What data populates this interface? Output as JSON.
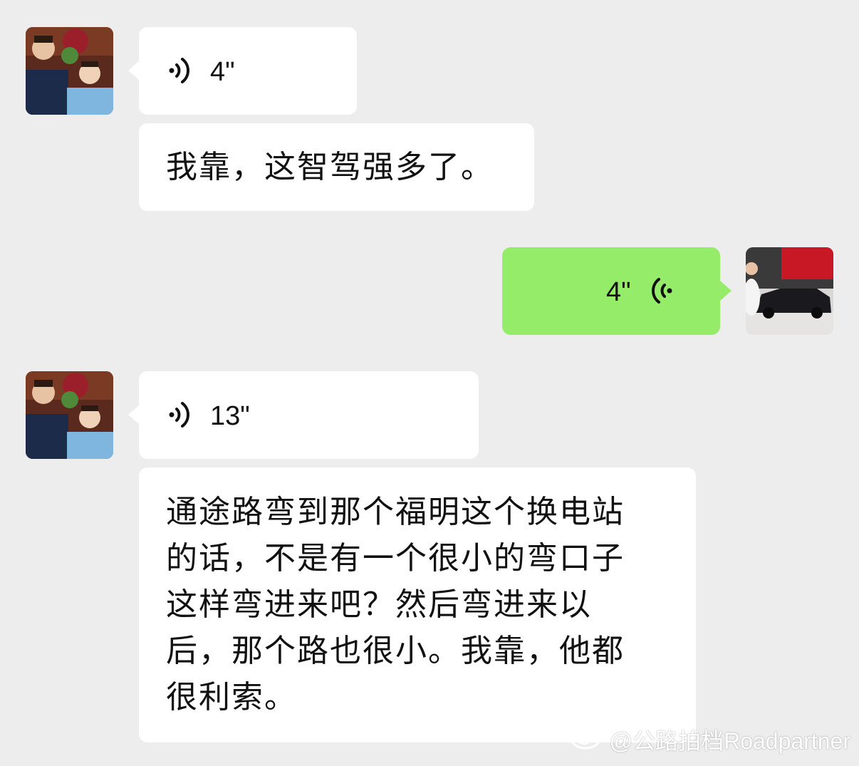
{
  "messages": [
    {
      "type": "voice",
      "direction": "in",
      "duration": "4\""
    },
    {
      "type": "text",
      "direction": "in",
      "text": "我靠，这智驾强多了。"
    },
    {
      "type": "voice",
      "direction": "out",
      "duration": "4\""
    },
    {
      "type": "voice",
      "direction": "in",
      "duration": "13\""
    },
    {
      "type": "text",
      "direction": "in",
      "lines": [
        "通途路弯到那个福明这个换电站",
        "的话，不是有一个很小的弯口子",
        "这样弯进来吧？然后弯进来以",
        "后，那个路也很小。我靠，他都",
        "很利索。"
      ]
    }
  ],
  "watermark": "@公路拍档Roadpartner",
  "colors": {
    "background": "#ededed",
    "incoming": "#ffffff",
    "outgoing": "#95ec69"
  }
}
